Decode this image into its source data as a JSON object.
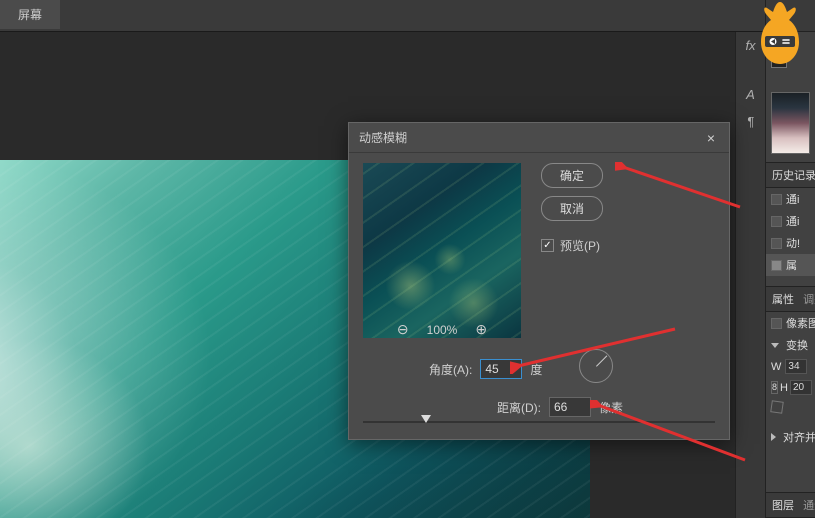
{
  "tab_title": "屏幕",
  "sidebar_icons": [
    "fx",
    "A",
    "¶"
  ],
  "dialog": {
    "title": "动感模糊",
    "ok": "确定",
    "cancel": "取消",
    "preview_label": "预览(P)",
    "preview_checked": true,
    "zoom": "100%",
    "angle_label": "角度(A):",
    "angle_value": "45",
    "angle_unit": "度",
    "distance_label": "距离(D):",
    "distance_value": "66",
    "distance_unit": "像素"
  },
  "panels": {
    "history_tab": "历史记录",
    "history_items": [
      "通i",
      "通i",
      "动!",
      "属"
    ],
    "properties_tab": "属性",
    "adjust_tab": "调整",
    "pixel_label": "像素图",
    "transform_label": "变换",
    "w_label": "W",
    "w_value": "34",
    "h_label": "H",
    "h_value": "20",
    "align_label": "对齐并分布",
    "layers_tab": "图层",
    "channels_tab": "通道"
  },
  "zoom_out_icon": "⊖",
  "zoom_in_icon": "⊕",
  "close_icon": "×",
  "check_icon": "✓"
}
